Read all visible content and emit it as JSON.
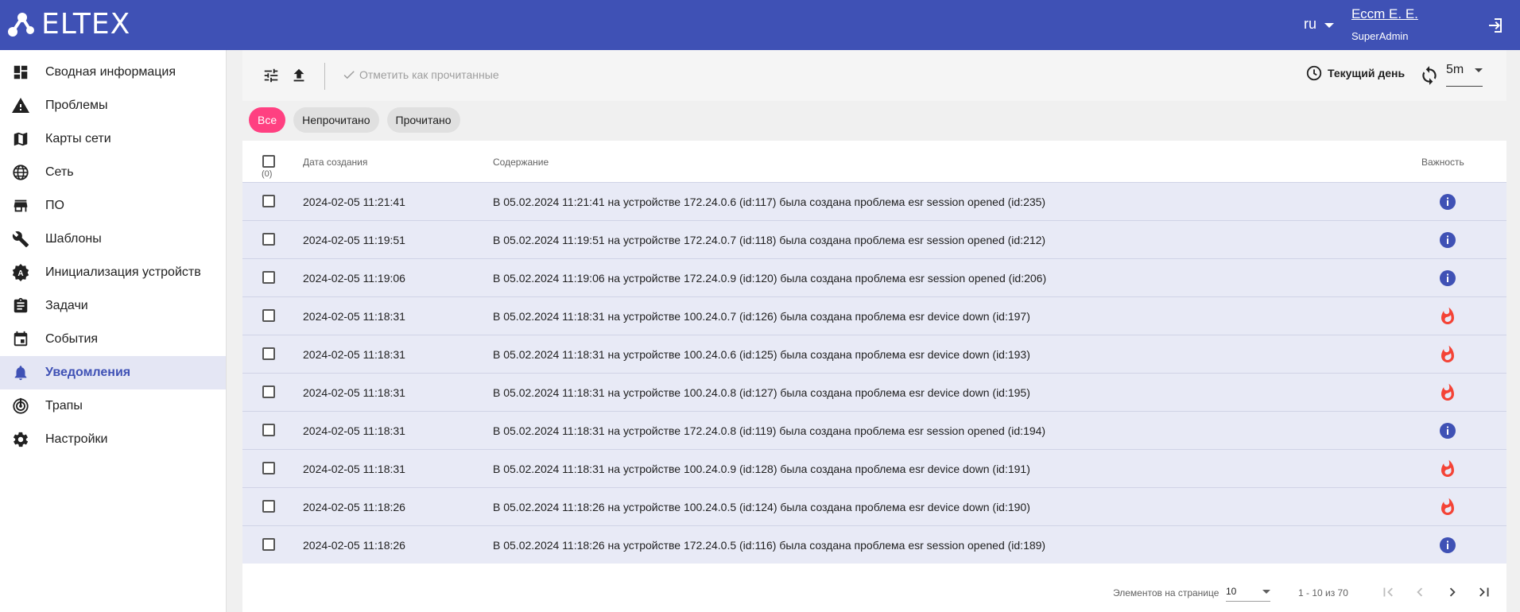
{
  "header": {
    "brand": "ELTEX",
    "language": "ru",
    "user_name": "Ессm E. E.",
    "user_role": "SuperAdmin",
    "bg_color": "#3f51b5"
  },
  "sidebar": {
    "items": [
      {
        "label": "Сводная информация",
        "icon": "dashboard-icon"
      },
      {
        "label": "Проблемы",
        "icon": "warning-icon"
      },
      {
        "label": "Карты сети",
        "icon": "map-icon"
      },
      {
        "label": "Сеть",
        "icon": "globe-icon"
      },
      {
        "label": "ПО",
        "icon": "store-icon"
      },
      {
        "label": "Шаблоны",
        "icon": "wrench-icon"
      },
      {
        "label": "Инициализация устройств",
        "icon": "auto-badge-icon"
      },
      {
        "label": "Задачи",
        "icon": "clipboard-icon"
      },
      {
        "label": "События",
        "icon": "calendar-icon"
      },
      {
        "label": "Уведомления",
        "icon": "bell-icon",
        "active": true
      },
      {
        "label": "Трапы",
        "icon": "radar-icon"
      },
      {
        "label": "Настройки",
        "icon": "gear-icon"
      }
    ],
    "active_color": "#3f51b5"
  },
  "toolbar": {
    "mark_read_label": "Отметить как прочитанные",
    "current_day_label": "Текущий день",
    "refresh_interval": "5m"
  },
  "filters": {
    "chips": [
      "Все",
      "Непрочитано",
      "Прочитано"
    ],
    "active": "Все",
    "active_color": "#ff4081"
  },
  "table": {
    "columns": {
      "date": "Дата создания",
      "content": "Содержание",
      "severity": "Важность"
    },
    "selected_count": "(0)",
    "rows": [
      {
        "date": "2024-02-05 11:21:41",
        "content": "В 05.02.2024 11:21:41 на устройстве 172.24.0.6 (id:117) была создана проблема esr session opened (id:235)",
        "severity": "info"
      },
      {
        "date": "2024-02-05 11:19:51",
        "content": "В 05.02.2024 11:19:51 на устройстве 172.24.0.7 (id:118) была создана проблема esr session opened (id:212)",
        "severity": "info"
      },
      {
        "date": "2024-02-05 11:19:06",
        "content": "В 05.02.2024 11:19:06 на устройстве 172.24.0.9 (id:120) была создана проблема esr session opened (id:206)",
        "severity": "info"
      },
      {
        "date": "2024-02-05 11:18:31",
        "content": "В 05.02.2024 11:18:31 на устройстве 100.24.0.7 (id:126) была создана проблема esr device down (id:197)",
        "severity": "critical"
      },
      {
        "date": "2024-02-05 11:18:31",
        "content": "В 05.02.2024 11:18:31 на устройстве 100.24.0.6 (id:125) была создана проблема esr device down (id:193)",
        "severity": "critical"
      },
      {
        "date": "2024-02-05 11:18:31",
        "content": "В 05.02.2024 11:18:31 на устройстве 100.24.0.8 (id:127) была создана проблема esr device down (id:195)",
        "severity": "critical"
      },
      {
        "date": "2024-02-05 11:18:31",
        "content": "В 05.02.2024 11:18:31 на устройстве 172.24.0.8 (id:119) была создана проблема esr session opened (id:194)",
        "severity": "info"
      },
      {
        "date": "2024-02-05 11:18:31",
        "content": "В 05.02.2024 11:18:31 на устройстве 100.24.0.9 (id:128) была создана проблема esr device down (id:191)",
        "severity": "critical"
      },
      {
        "date": "2024-02-05 11:18:26",
        "content": "В 05.02.2024 11:18:26 на устройстве 100.24.0.5 (id:124) была создана проблема esr device down (id:190)",
        "severity": "critical"
      },
      {
        "date": "2024-02-05 11:18:26",
        "content": "В 05.02.2024 11:18:26 на устройстве 172.24.0.5 (id:116) была создана проблема esr session opened (id:189)",
        "severity": "info"
      }
    ],
    "severity_colors": {
      "info": "#3f51b5",
      "critical": "#f44336"
    }
  },
  "paginator": {
    "items_per_page_label": "Элементов на странице",
    "page_size": "10",
    "range_label": "1 - 10 из 70"
  }
}
